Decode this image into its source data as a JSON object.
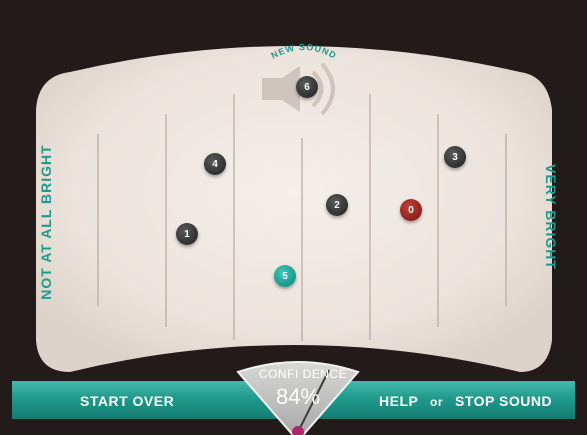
{
  "axis": {
    "left_label": "NOT AT ALL BRIGHT",
    "right_label": "VERY BRIGHT"
  },
  "new_sound": {
    "label": "NEW SOUND",
    "marker": "6"
  },
  "markers": [
    {
      "label": "4",
      "color": "gray"
    },
    {
      "label": "3",
      "color": "gray"
    },
    {
      "label": "2",
      "color": "gray"
    },
    {
      "label": "0",
      "color": "red"
    },
    {
      "label": "1",
      "color": "gray"
    },
    {
      "label": "5",
      "color": "teal"
    }
  ],
  "footer": {
    "start_over": "START OVER",
    "help": "HELP",
    "or": "or",
    "stop_sound": "STOP SOUND"
  },
  "confidence": {
    "label": "CONFI DENCE",
    "value": "84%"
  },
  "icons": {
    "speaker": "speaker-icon"
  },
  "colors": {
    "accent": "#1f9b8e",
    "panel": "#efe8e2",
    "background": "#231b19",
    "marker_gray": "#3a3a3a",
    "marker_red": "#a92a25",
    "marker_teal": "#1fb0a2"
  }
}
